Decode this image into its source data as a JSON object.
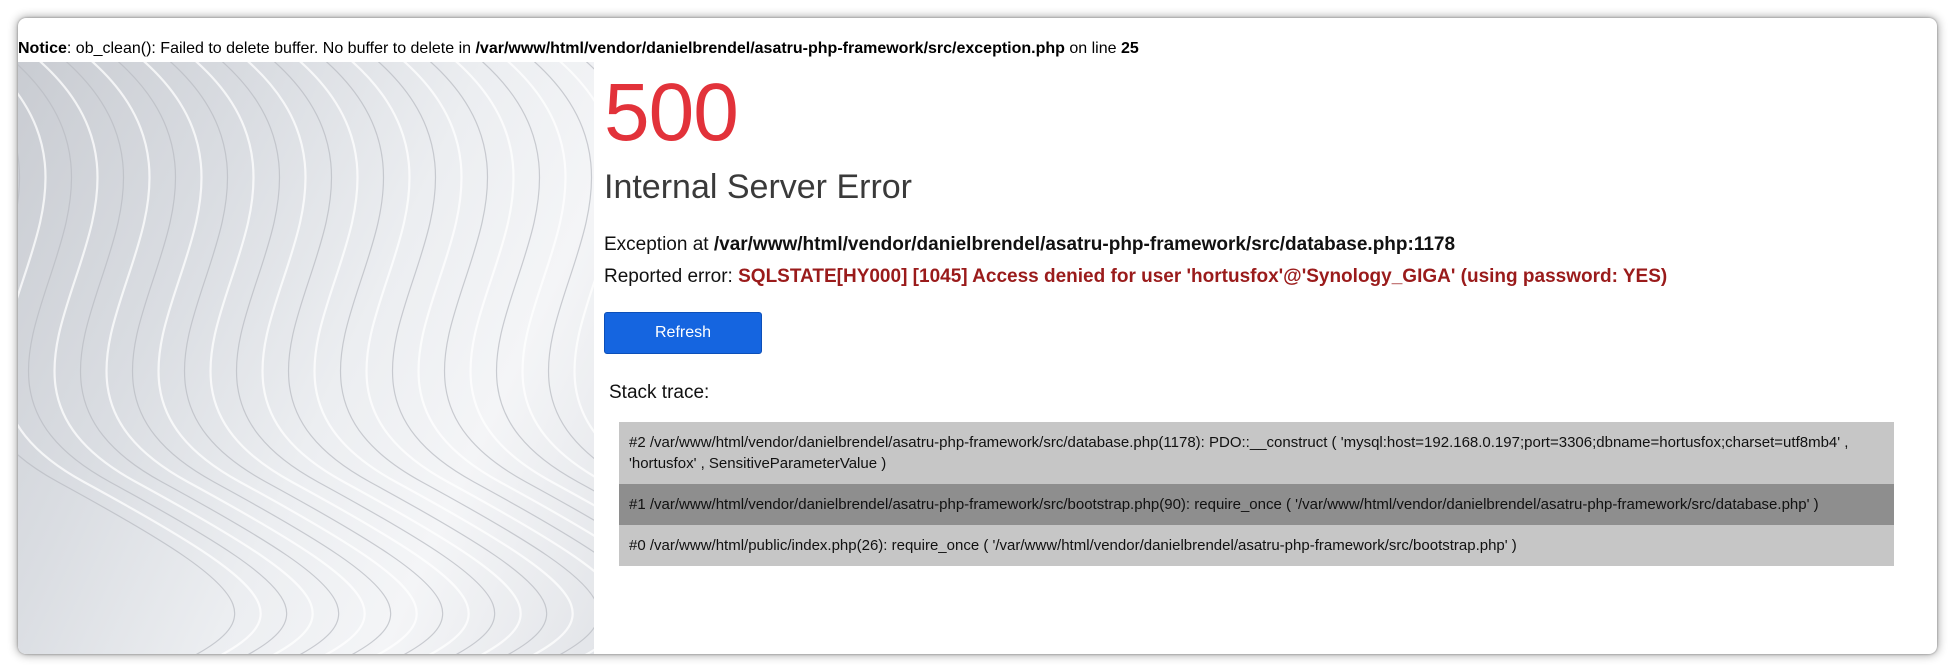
{
  "notice": {
    "label": "Notice",
    "message": ": ob_clean(): Failed to delete buffer. No buffer to delete in ",
    "file": "/var/www/html/vendor/danielbrendel/asatru-php-framework/src/exception.php",
    "on_line_text": " on line ",
    "line": "25"
  },
  "error": {
    "code": "500",
    "title": "Internal Server Error",
    "exception_prefix": "Exception at ",
    "exception_path": "/var/www/html/vendor/danielbrendel/asatru-php-framework/src/database.php:1178",
    "reported_prefix": "Reported error: ",
    "reported_message": "SQLSTATE[HY000] [1045] Access denied for user 'hortusfox'@'Synology_GIGA' (using password: YES)"
  },
  "refresh_label": "Refresh",
  "stack_label": "Stack trace:",
  "stack": [
    {
      "text": "#2 /var/www/html/vendor/danielbrendel/asatru-php-framework/src/database.php(1178): PDO::__construct ( 'mysql:host=192.168.0.197;port=3306;dbname=hortusfox;charset=utf8mb4' , 'hortusfox' , SensitiveParameterValue )"
    },
    {
      "text": "#1 /var/www/html/vendor/danielbrendel/asatru-php-framework/src/bootstrap.php(90): require_once ( '/var/www/html/vendor/danielbrendel/asatru-php-framework/src/database.php' )"
    },
    {
      "text": "#0 /var/www/html/public/index.php(26): require_once ( '/var/www/html/vendor/danielbrendel/asatru-php-framework/src/bootstrap.php' )"
    }
  ],
  "colors": {
    "code": "#e2323a",
    "reported_error": "#9a1b1b",
    "button": "#1565e0",
    "row_light": "#c6c6c6",
    "row_dark": "#8e8e8e"
  }
}
